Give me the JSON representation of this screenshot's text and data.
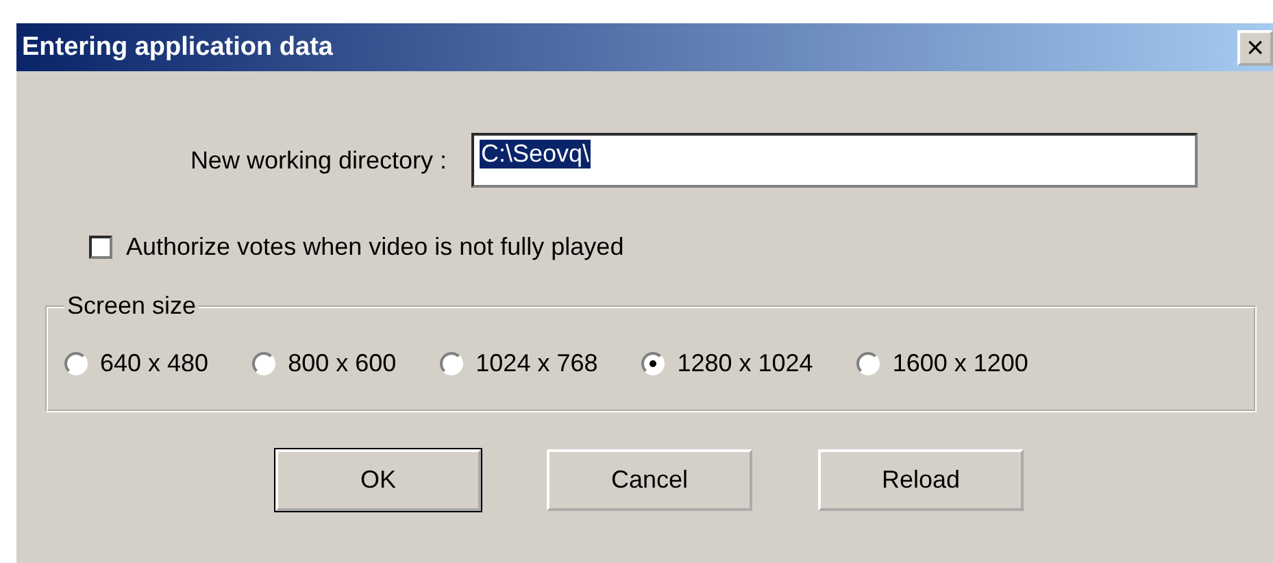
{
  "window": {
    "title": "Entering application data",
    "close": "×"
  },
  "directory": {
    "label": "New working directory :",
    "value": "C:\\Seovq\\",
    "selected_text": true
  },
  "authorize_votes": {
    "label": "Authorize votes when video is not fully played",
    "checked": false
  },
  "screen_size": {
    "title": "Screen size",
    "options": [
      {
        "label": "640 x 480",
        "selected": false
      },
      {
        "label": "800 x 600",
        "selected": false
      },
      {
        "label": "1024 x 768",
        "selected": false
      },
      {
        "label": "1280 x 1024",
        "selected": true
      },
      {
        "label": "1600 x 1200",
        "selected": false
      }
    ]
  },
  "buttons": [
    {
      "label": "OK",
      "default": true
    },
    {
      "label": "Cancel",
      "default": false
    },
    {
      "label": "Reload",
      "default": false
    }
  ]
}
